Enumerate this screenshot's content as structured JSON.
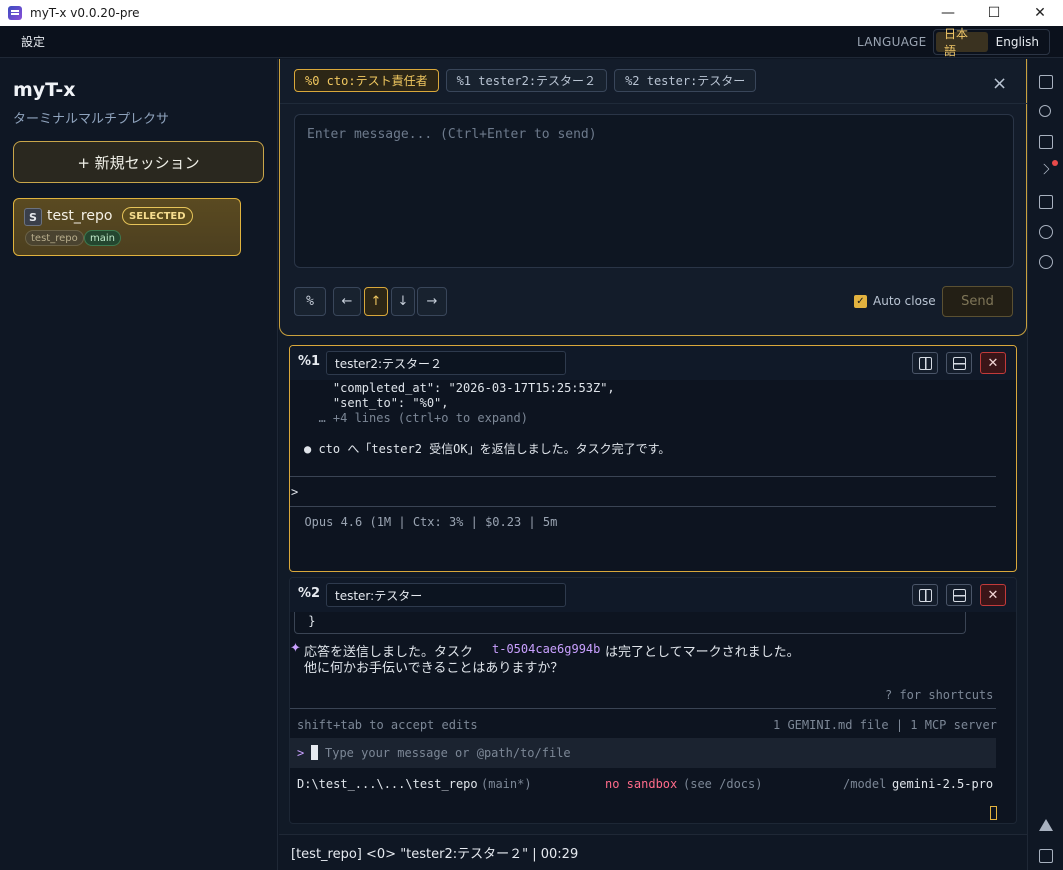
{
  "window": {
    "title": "myT-x v0.0.20-pre",
    "minimize": "—",
    "maximize": "☐",
    "close": "✕"
  },
  "menubar": {
    "settings": "設定",
    "language_label": "LANGUAGE",
    "lang_ja": "日本語",
    "lang_en": "English"
  },
  "sidebar": {
    "brand": "myT-x",
    "subtitle": "ターミナルマルチプレクサ",
    "new_session": "+ 新規セッション",
    "session": {
      "badge": "S",
      "name": "test_repo",
      "selected": "SELECTED",
      "repo_tag": "test_repo",
      "branch_tag": "main"
    }
  },
  "compose": {
    "tabs": [
      {
        "label": "%0 cto:テスト責任者"
      },
      {
        "label": "%1 tester2:テスター２"
      },
      {
        "label": "%2 tester:テスター"
      }
    ],
    "close": "×",
    "placeholder": "Enter message... (Ctrl+Enter to send)",
    "keys": {
      "percent": "%",
      "left": "←",
      "up": "↑",
      "down": "↓",
      "right": "→"
    },
    "auto_close": "Auto close",
    "send": "Send"
  },
  "pane1": {
    "id": "%1",
    "title": "tester2:テスター２",
    "close": "✕",
    "lines": {
      "l1": "    \"completed_at\": \"2026-03-17T15:25:53Z\",",
      "l2": "    \"sent_to\": \"%0\",",
      "l3": "  … +4 lines (ctrl+o to expand)",
      "l4": "● cto へ「tester2 受信OK」を返信しました。タスク完了です。",
      "prompt": ">",
      "status": "  Opus 4.6 (1M | Ctx: 3% | $0.23 | 5m"
    }
  },
  "pane2": {
    "id": "%2",
    "title": "tester:テスター",
    "close": "✕",
    "lines": {
      "brace": " }",
      "star": "✦",
      "msg_a": "応答を送信しました。タスク",
      "task_id": "t-0504cae6g994b",
      "msg_b": "は完了としてマークされました。",
      "msg_c": "他に何かお手伝いできることはありますか？",
      "shortcuts": "? for shortcuts",
      "accept": "shift+tab to accept edits",
      "files": "1 GEMINI.md file | 1 MCP server",
      "input_prompt": ">",
      "input_placeholder": "Type your message or @path/to/file",
      "path": "D:\\test_...\\...\\test_repo",
      "branch": "(main*)",
      "sandbox": "no sandbox",
      "sandbox_hint": "(see /docs)",
      "model_label": "/model",
      "model": "gemini-2.5-pro"
    }
  },
  "statusbar": {
    "text": "[test_repo] <0> \"tester2:テスター２\" | 00:29"
  },
  "colors": {
    "accent": "#d9a83b",
    "bg": "#0f1724",
    "danger": "#c23a3a",
    "task_id": "#c9a0ff",
    "sandbox": "#ff6b8a"
  }
}
